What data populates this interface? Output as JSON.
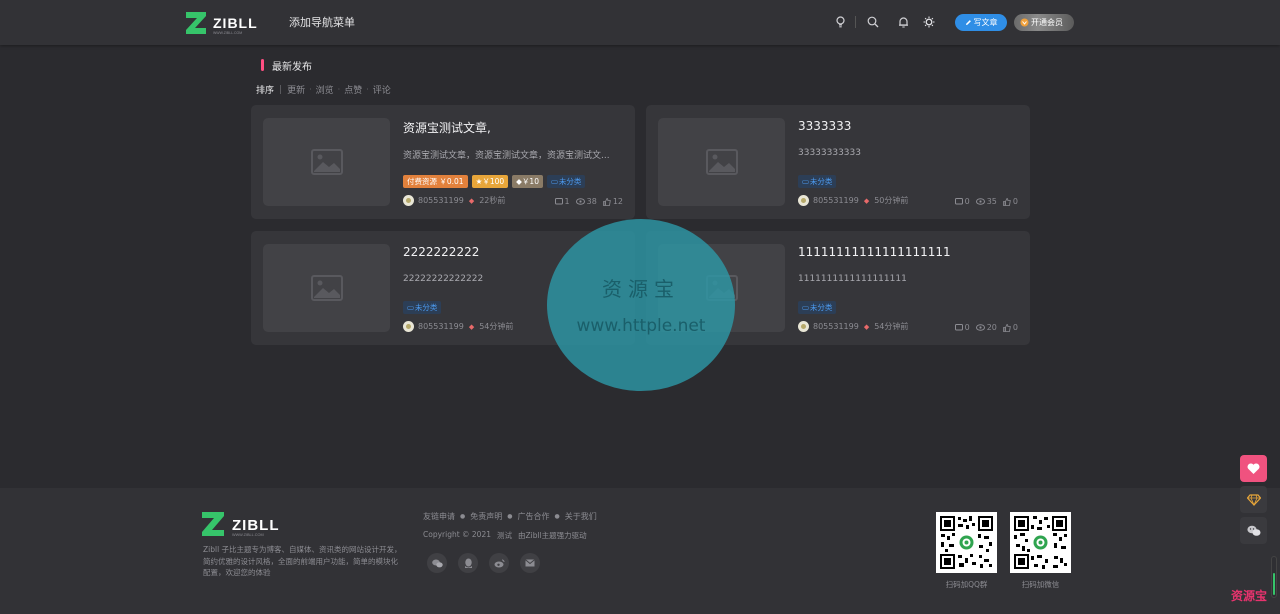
{
  "header": {
    "logo_sub": "WWW.ZIBLL.COM",
    "nav_item": "添加导航菜单",
    "write_label": "写文章",
    "vip_label": "开通会员"
  },
  "section": {
    "title": "最新发布",
    "sort_label": "排序",
    "sort_options": [
      "更新",
      "浏览",
      "点赞",
      "评论"
    ]
  },
  "posts": [
    {
      "title": "资源宝测试文章,",
      "excerpt": "资源宝测试文章，资源宝测试文章，资源宝测试文...",
      "tags": {
        "pay": "付费资源 ￥0.01",
        "points": "￥100",
        "vip": "￥10",
        "category": "未分类"
      },
      "author": "805531199",
      "time": "22秒前",
      "comments": "1",
      "views": "38",
      "likes": "12"
    },
    {
      "title": "3333333",
      "excerpt": "33333333333",
      "tags": {
        "category": "未分类"
      },
      "author": "805531199",
      "time": "50分钟前",
      "comments": "0",
      "views": "35",
      "likes": "0"
    },
    {
      "title": "2222222222",
      "excerpt": "22222222222222",
      "tags": {
        "category": "未分类"
      },
      "author": "805531199",
      "time": "54分钟前",
      "comments": "",
      "views": "",
      "likes": ""
    },
    {
      "title": "11111111111111111111",
      "excerpt": "1111111111111111111",
      "tags": {
        "category": "未分类"
      },
      "author": "805531199",
      "time": "54分钟前",
      "comments": "0",
      "views": "20",
      "likes": "0"
    }
  ],
  "watermark": {
    "line1": "资源宝",
    "line2": "www.httple.net"
  },
  "footer": {
    "logo_sub": "WWW.ZIBLL.COM",
    "description": "Zibll 子比主题专为博客、自媒体、资讯类的网站设计开发，简约优雅的设计风格，全面的前端用户功能，简单的模块化配置，欢迎您的体验",
    "links": [
      "友链申请",
      "免责声明",
      "广告合作",
      "关于我们"
    ],
    "copyright": "Copyright © 2021",
    "copy_extra1": "测试",
    "copy_extra2": "由Zibll主题强力驱动",
    "qr1_caption": "扫码加QQ群",
    "qr2_caption": "扫码加微信"
  },
  "corner_watermark": "资源宝",
  "colors": {
    "accent_pink": "#ff4f82",
    "accent_blue": "#2f8ee6",
    "brand_green": "#36c46a"
  }
}
